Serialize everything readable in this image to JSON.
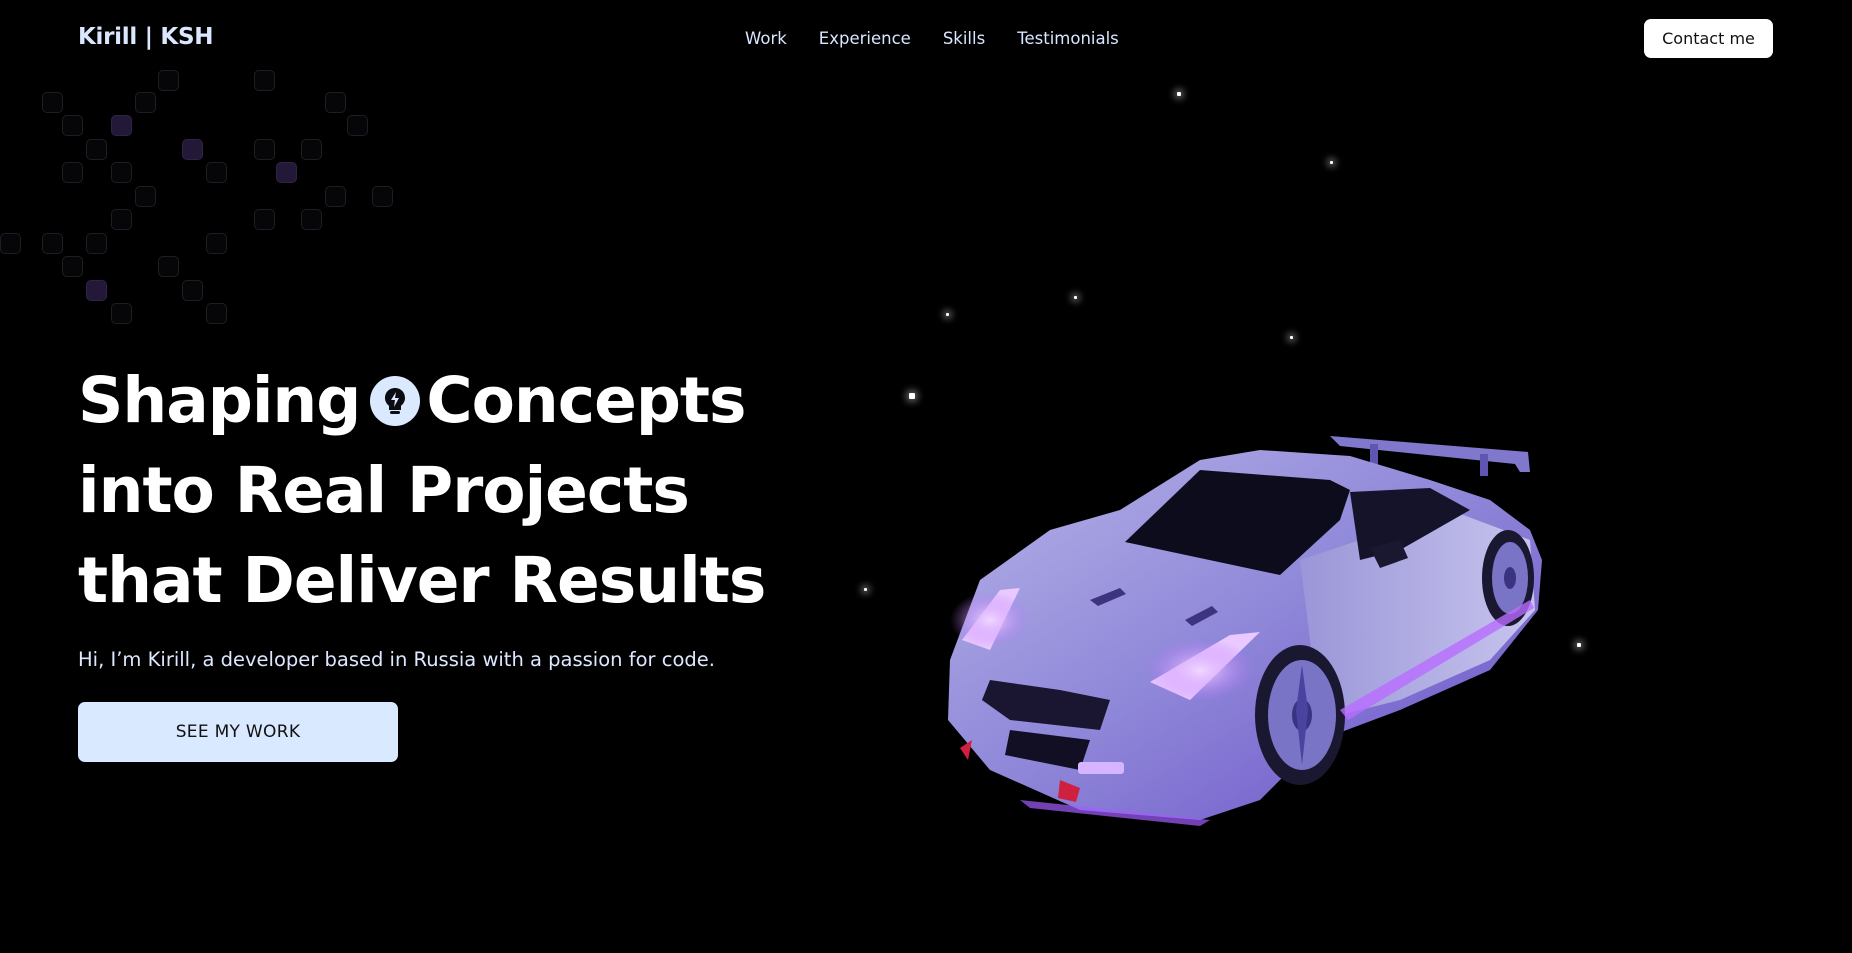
{
  "header": {
    "brand": "Kirill | KSH",
    "nav": [
      "Work",
      "Experience",
      "Skills",
      "Testimonials"
    ],
    "contact_label": "Contact me"
  },
  "hero": {
    "title_line1_a": "Shaping",
    "badge_icon": "bulb-icon",
    "title_line1_b": "Concepts",
    "title_line2": "into Real Projects",
    "title_line3": "that Deliver Results",
    "subtitle": "Hi, I’m Kirill, a developer based in Russia with a passion for code.",
    "cta_label": "SEE MY WORK"
  },
  "colors": {
    "background": "#000000",
    "accent": "#d9e9ff",
    "car_body": "#8a82d6",
    "car_glow": "#a35cff"
  }
}
